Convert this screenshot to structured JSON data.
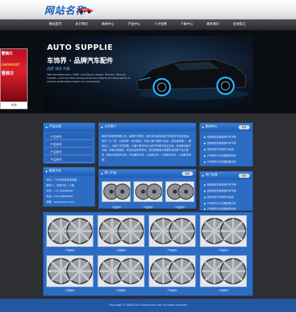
{
  "header": {
    "logo": "网站名称"
  },
  "nav": [
    "网站首页",
    "关于我们",
    "新闻中心",
    "产品中心",
    "人才招聘",
    "下载中心",
    "联系我们",
    "在线留言"
  ],
  "banner": {
    "title": "AUTO SUPPLIE",
    "subtitle": "车饰界 · 品牌汽车配件",
    "tags": "品质    诚信    共赢",
    "text": "Well Mercedes-Benz, BMW, Land Rover, Jaguar, Porsche, Renault, Cadillac, Audi and other famous business imports of strong pieces of original professional import car accessories."
  },
  "ad": {
    "brand": "雪佛兰",
    "brand_en": "CHEVROLET",
    "brand3": "雪佛兰",
    "close": "关闭"
  },
  "sidebar": {
    "category_title": "产品分类",
    "categories": [
      "产品系列",
      "产品系列",
      "产品系列",
      "产品系列"
    ],
    "contact_title": "联系方式",
    "contact_lines": [
      "地址：广州市某某区某某路",
      "联系人：某某先生 / 小姐",
      "手机：131-88888888",
      "电话：020-88888888",
      "邮箱：www.xxxxx.com"
    ]
  },
  "about": {
    "title": "公司简介",
    "text": "某某汽车配件有限公司，经营汽车配件，致力成为某某地区汽车配件专业供应商，我们一心一意，为您带来一站式服务，时刻以客户满意为目标，坚持品质第一，服务至上，与客户共同发展，为客户提供专业化的汽车配件供应方案，欢迎新老客户光临，真诚为您服务，热忱欢迎您的来电，我们将竭诚为您提供优质的产品与服务，期待与您携手共进，共创美好未来，以诚信为本，以质量求生存，以创新求发展。"
  },
  "hot_products": {
    "title": "热门产品",
    "more": "更多",
    "caption": "产品系列"
  },
  "news": {
    "title": "新闻中心",
    "more": "更多",
    "items": [
      "西部地区的新能源汽车市场",
      "西部地区的新能源汽车市场",
      "如何选择汽车配件与用品",
      "汽车配件行业发展趋势分析",
      "汽车配件行业发展趋势分析"
    ]
  },
  "hot_news": {
    "title": "热门文章",
    "more": "更多",
    "items": [
      "西部地区的新能源汽车市场",
      "西部地区的新能源汽车市场",
      "如何选择汽车配件与用品",
      "汽车配件行业发展趋势分析",
      "汽车配件行业发展趋势分析"
    ]
  },
  "gallery": {
    "caption": "产品系列"
  },
  "footer": {
    "text": "Copyright © 2009-2014 www.yxxxx.com All rights reserved"
  }
}
